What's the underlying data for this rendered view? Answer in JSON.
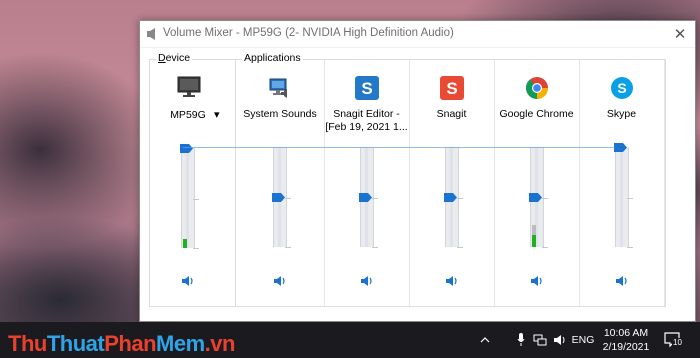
{
  "window": {
    "title": "Volume Mixer - MP59G (2- NVIDIA High Definition Audio)",
    "close_glyph": "✕"
  },
  "device": {
    "group_label": "Device",
    "group_label_access_key": "D",
    "name": "MP59G",
    "dropdown_glyph": "▾",
    "volume_percent": 100,
    "meter_level_fraction": 0.09
  },
  "applications": {
    "group_label": "Applications",
    "items": [
      {
        "label_line1": "System Sounds",
        "label_line2": "",
        "icon": "system-sounds-icon",
        "volume_percent": 50,
        "meter_level_fraction": 0
      },
      {
        "label_line1": "Snagit Editor -",
        "label_line2": "[Feb 19, 2021 1...",
        "icon": "snagit-editor-icon",
        "volume_percent": 50,
        "meter_level_fraction": 0
      },
      {
        "label_line1": "Snagit",
        "label_line2": "",
        "icon": "snagit-icon",
        "volume_percent": 50,
        "meter_level_fraction": 0
      },
      {
        "label_line1": "Google Chrome",
        "label_line2": "",
        "icon": "chrome-icon",
        "volume_percent": 50,
        "meter_level_fraction": 0.22
      },
      {
        "label_line1": "Skype",
        "label_line2": "",
        "icon": "skype-icon",
        "volume_percent": 100,
        "meter_level_fraction": 0
      }
    ]
  },
  "taskbar": {
    "watermark": "ThuThuatPhanMem.vn",
    "language": "ENG",
    "time": "10:06 AM",
    "date": "2/19/2021",
    "notification_count": "10"
  },
  "colors": {
    "accent": "#1a73d1",
    "meter_green": "#20b020",
    "snagit_red": "#e94a35",
    "snagit_blue": "#2478c8",
    "skype_blue": "#0aa0e6"
  }
}
